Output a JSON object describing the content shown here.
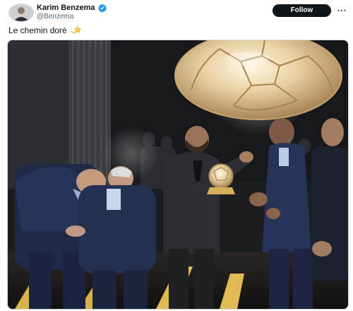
{
  "tweet": {
    "author": {
      "display_name": "Karim Benzema",
      "handle": "@Benzema",
      "verified": true,
      "avatar_icon": "profile-avatar"
    },
    "follow_label": "Follow",
    "more_icon": "more-horizontal-icon",
    "text": "Le chemin doré",
    "text_emoji": "dizzy-star-emoji",
    "media": {
      "type": "photo",
      "subject_icon": "ballon-dor-trophy"
    }
  },
  "colors": {
    "follow_bg": "#0f1419",
    "verified": "#1d9bf0",
    "handle": "#536471",
    "photo_border": "#cfd9de"
  }
}
